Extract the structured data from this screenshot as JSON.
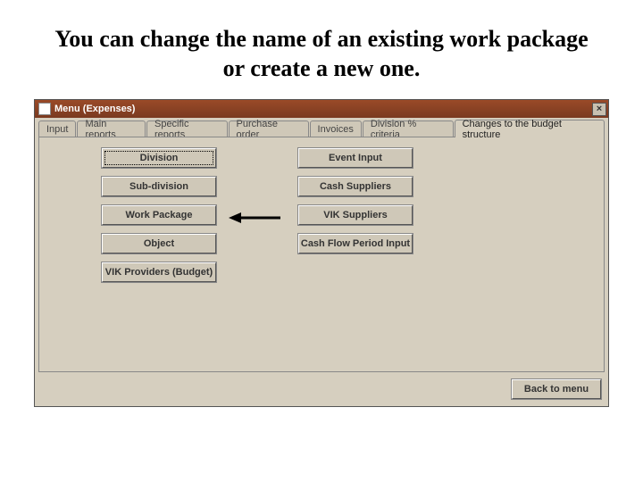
{
  "slide": {
    "title": "You can change the name of an existing work package or create a new one."
  },
  "window": {
    "title": "Menu (Expenses)",
    "close_symbol": "×"
  },
  "tabs": [
    {
      "label": "Input",
      "active": false
    },
    {
      "label": "Main reports",
      "active": false
    },
    {
      "label": "Specific reports",
      "active": false
    },
    {
      "label": "Purchase order",
      "active": false
    },
    {
      "label": "Invoices",
      "active": false
    },
    {
      "label": "Division % criteria",
      "active": false
    },
    {
      "label": "Changes to the budget structure",
      "active": true
    }
  ],
  "left_buttons": [
    "Division",
    "Sub-division",
    "Work Package",
    "Object",
    "VIK Providers (Budget)"
  ],
  "right_buttons": [
    "Event Input",
    "Cash Suppliers",
    "VIK Suppliers",
    "Cash Flow Period Input"
  ],
  "back_button": "Back to menu"
}
